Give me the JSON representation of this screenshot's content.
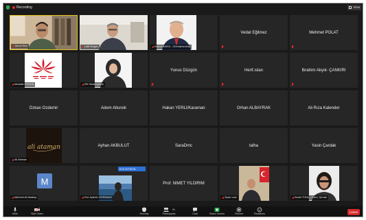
{
  "topbar": {
    "recording_label": "Recording",
    "view_label": "View"
  },
  "tiles": [
    {
      "type": "video",
      "tag": "Murat Ekiz"
    },
    {
      "type": "video",
      "tag": "Latif Sergen"
    },
    {
      "type": "video",
      "tag": "Kazım BAKIŞ - Gümüşhacıköy"
    },
    {
      "type": "name",
      "name": "Vedat Eğilmez"
    },
    {
      "type": "name",
      "name": "Mehmet POLAT"
    },
    {
      "type": "logo",
      "tag": "Mustafa ÖĞÜNK"
    },
    {
      "type": "video",
      "tag": "Elif Sbrahmanok"
    },
    {
      "type": "name",
      "name": "Yunus Düzgün"
    },
    {
      "type": "name",
      "name": "Herif.ıslan"
    },
    {
      "type": "name",
      "name": "İbrahim Akyol- ÇANKIRI"
    },
    {
      "type": "name",
      "name": "Özkan Özdemir"
    },
    {
      "type": "name",
      "name": "Adem Altunok"
    },
    {
      "type": "name",
      "name": "Hakan YERLİ/Karaman"
    },
    {
      "type": "name",
      "name": "Orhan ALBAYRAK"
    },
    {
      "type": "name",
      "name": "Ali Rıza Kalender"
    },
    {
      "type": "script",
      "tag": "Ali Ataman",
      "script_text": "ali ataman"
    },
    {
      "type": "name",
      "name": "Ayhan AKBULUT"
    },
    {
      "type": "name",
      "name": "SaraDmc"
    },
    {
      "type": "name",
      "name": "talha"
    },
    {
      "type": "name",
      "name": "Yasin Çardak"
    },
    {
      "type": "avatar",
      "tag": "Mehmet Ali Akabay",
      "initial": "M"
    },
    {
      "type": "video",
      "tag": "Ece Aytekin GÖRKMAZ",
      "badge": "ECE AYTEKİN"
    },
    {
      "type": "name",
      "name": "Prof. NİMET YILDIRIM"
    },
    {
      "type": "video",
      "tag": "Ziyan ucar"
    },
    {
      "type": "video",
      "tag": "İsmail TÜNÇ - Cizre, Şırnak"
    }
  ],
  "toolbar": {
    "items": [
      {
        "label": "Mute",
        "icon": "mic-icon"
      },
      {
        "label": "Start Video",
        "icon": "video-icon"
      },
      {
        "label": "Security",
        "icon": "shield-icon"
      },
      {
        "label": "Participants",
        "icon": "participants-icon",
        "count": "91"
      },
      {
        "label": "Chat",
        "icon": "chat-icon"
      },
      {
        "label": "Share Screen",
        "icon": "share-screen-icon"
      },
      {
        "label": "Record",
        "icon": "record-icon"
      },
      {
        "label": "Reactions",
        "icon": "reactions-icon"
      }
    ],
    "end_label": "Leave"
  },
  "colors": {
    "background": "#1a1a1a",
    "tile": "#262626",
    "active_border": "#e6c51c",
    "end_button": "#d42b2b",
    "share_green": "#2da44e",
    "muted_red": "#e02828"
  }
}
